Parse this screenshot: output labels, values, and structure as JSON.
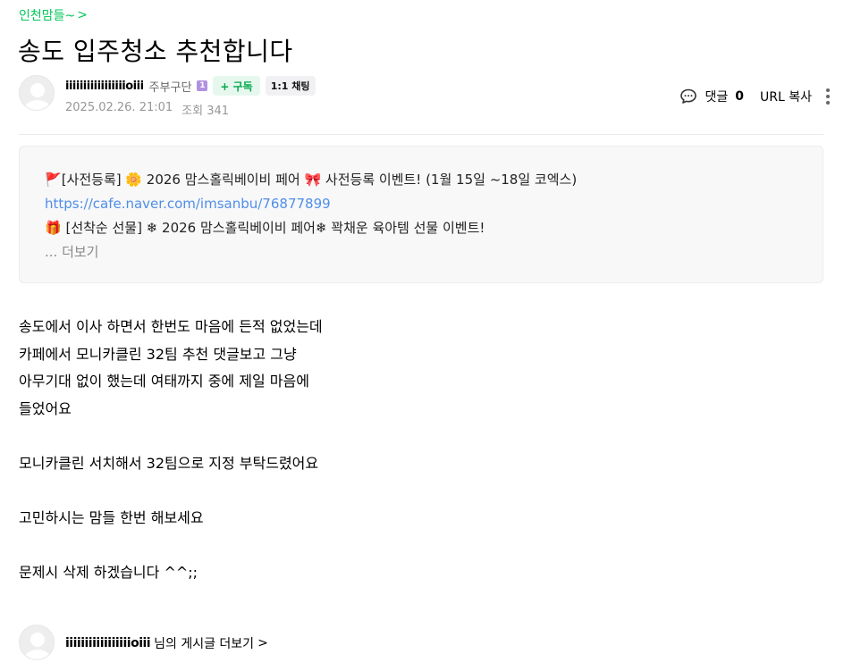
{
  "cafe": {
    "name": "인천맘들~",
    "chevron": ">"
  },
  "post": {
    "title": "송도 입주청소 추천합니다",
    "author": {
      "nickname": "iiiiiiiiiiiiiiiiioiii",
      "grade": "주부구단",
      "grade_badge": "1",
      "subscribe_label": "+ 구독",
      "chat_label": "1:1 채팅"
    },
    "date": "2025.02.26. 21:01",
    "views_label": "조회 341",
    "tools": {
      "comment_label": "댓글",
      "comment_count": "0",
      "url_copy": "URL 복사"
    }
  },
  "notice": {
    "line1": "[사전등록] 🌼 2026 맘스홀릭베이비 페어 🎀 사전등록 이벤트! (1월 15일 ~18일 코엑스)",
    "line1_flag": "🚩",
    "link": "https://cafe.naver.com/imsanbu/76877899",
    "line3_gift": "🎁",
    "line3": "[선착순 선물] ❄ 2026 맘스홀릭베이비 페어❄ 꽉채운 육아템 선물 이벤트!",
    "more": "... 더보기"
  },
  "content": {
    "paragraphs": [
      "송도에서 이사 하면서 한번도 마음에 든적 없었는데",
      "카페에서 모니카클린 32팀 추천 댓글보고 그냥",
      "아무기대 없이 했는데 여태까지 중에 제일 마음에",
      "들었어요",
      "",
      "모니카클린 서치해서 32팀으로 지정 부탁드렸어요",
      "",
      "고민하시는 맘들 한번 해보세요",
      "",
      "문제시 삭제 하겠습니다 ^^;;"
    ]
  },
  "footer": {
    "nickname": "iiiiiiiiiiiiiiiiioiii",
    "suffix": "님의 게시글 더보기",
    "chevron": ">"
  },
  "colors": {
    "accent": "#03c75a",
    "link": "#4f8ee7",
    "meta": "#979797"
  }
}
